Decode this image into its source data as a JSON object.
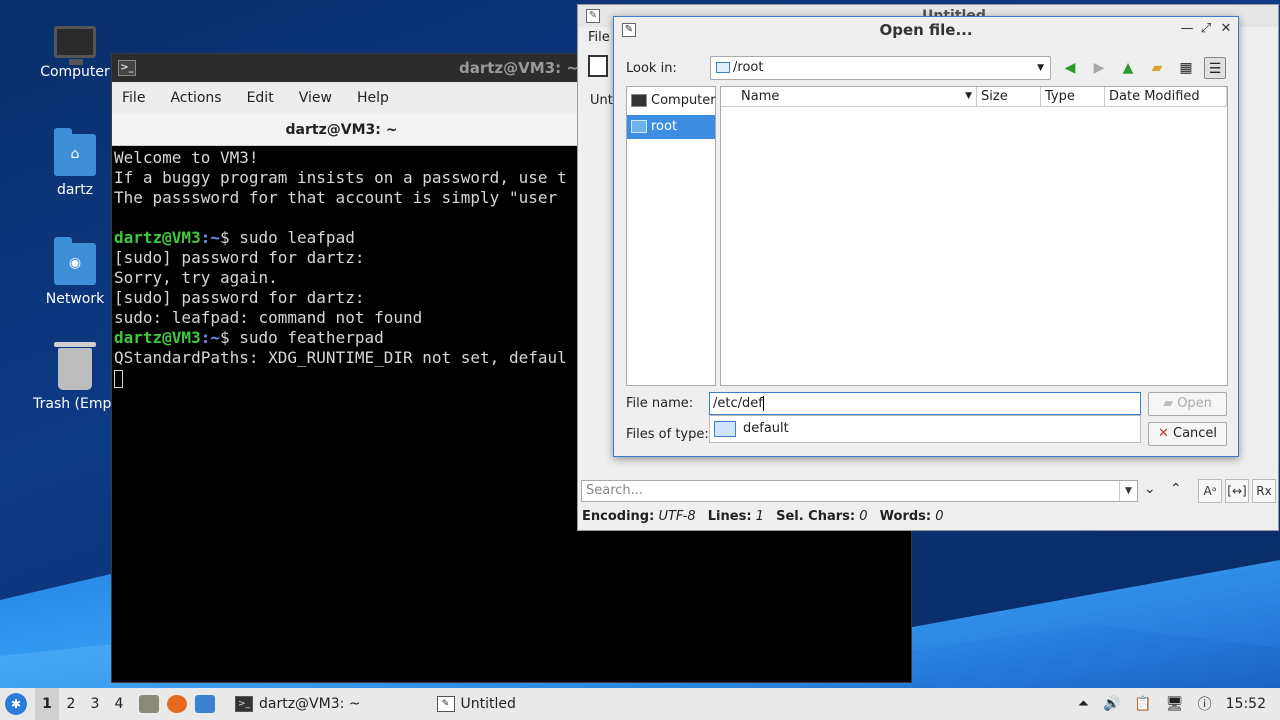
{
  "desktop": {
    "icons": [
      {
        "label": "Computer"
      },
      {
        "label": "dartz"
      },
      {
        "label": "Network"
      },
      {
        "label": "Trash (Empt"
      }
    ]
  },
  "terminal": {
    "title": "dartz@VM3: ~",
    "menu": [
      "File",
      "Actions",
      "Edit",
      "View",
      "Help"
    ],
    "tab_title": "dartz@VM3: ~",
    "lines": {
      "l1": "Welcome to VM3!",
      "l2": "If a buggy program insists on a password, use t",
      "l3": "The passsword for that account is simply \"user",
      "prompt_user": "dartz@VM3",
      "prompt_path": ":~",
      "cmd1": "$ sudo leafpad",
      "l5": "[sudo] password for dartz:",
      "l6": "Sorry, try again.",
      "l7": "[sudo] password for dartz:",
      "l8": "sudo: leafpad: command not found",
      "cmd2": "$ sudo featherpad",
      "l10": "QStandardPaths: XDG_RUNTIME_DIR not set, defaul"
    }
  },
  "featherpad": {
    "title": "Untitled",
    "menu_file": "File",
    "tab": "Unti",
    "search_placeholder": "Search...",
    "status": {
      "encoding_label": "Encoding:",
      "encoding": "UTF-8",
      "lines_label": "Lines:",
      "lines": "1",
      "sel_label": "Sel. Chars:",
      "sel": "0",
      "words_label": "Words:",
      "words": "0"
    }
  },
  "dialog": {
    "title": "Open file...",
    "look_in_label": "Look in:",
    "look_in_value": "/root",
    "sidebar": [
      "Computer",
      "root"
    ],
    "columns": [
      "Name",
      "Size",
      "Type",
      "Date Modified"
    ],
    "file_name_label": "File name:",
    "file_name_value": "/etc/def",
    "files_of_type_label": "Files of type:",
    "completion": "default",
    "open_label": "Open",
    "cancel_label": "Cancel"
  },
  "taskbar": {
    "workspaces": [
      "1",
      "2",
      "3",
      "4"
    ],
    "tasks": [
      "dartz@VM3: ~",
      "Untitled"
    ],
    "clock": "15:52"
  },
  "colors": {
    "accent": "#3d8ee0",
    "prompt_green": "#3ec93e",
    "prompt_blue": "#6e8ef5"
  }
}
